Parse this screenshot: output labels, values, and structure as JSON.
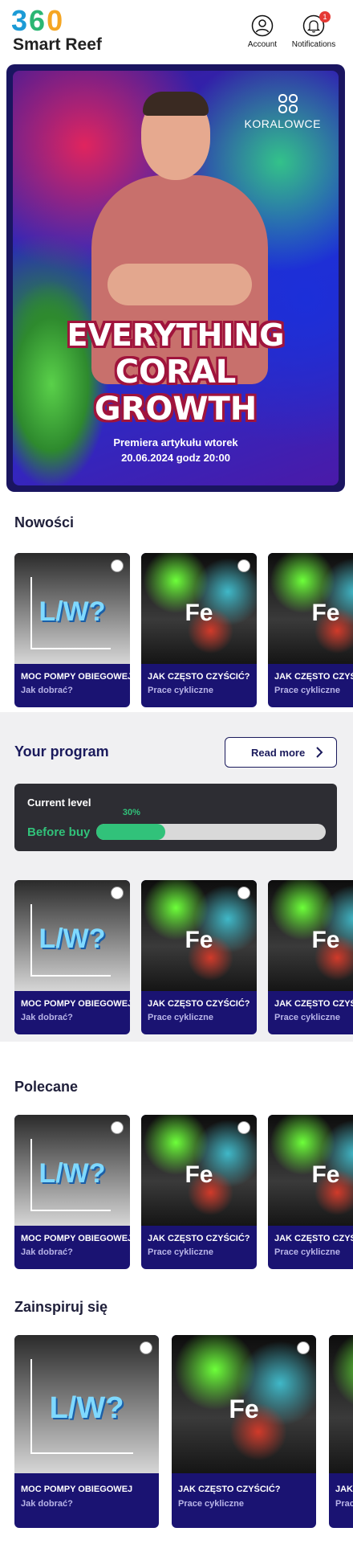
{
  "header": {
    "logo_number": "360",
    "logo_text": "Smart Reef",
    "account_label": "Account",
    "notifications_label": "Notifications",
    "notifications_count": "1"
  },
  "hero": {
    "brand": "KORALOWCE",
    "title_line1": "EVERYTHING",
    "title_line2": "CORAL",
    "title_line3": "GROWTH",
    "subtitle_line1": "Premiera artykułu wtorek",
    "subtitle_line2": "20.06.2024 godz 20:00"
  },
  "sections": {
    "nowosci": "Nowości",
    "program": "Your program",
    "polecane": "Polecane",
    "zainspiruj": "Zainspiruj się"
  },
  "program": {
    "read_more": "Read more",
    "current_level_label": "Current level",
    "stage": "Before buy",
    "progress_percent": 30,
    "progress_label": "30%"
  },
  "cards": [
    {
      "image_text": "L/W?",
      "title": "MOC POMPY OBIEGOWEJ",
      "subtitle": "Jak dobrać?"
    },
    {
      "image_text": "Fe",
      "title": "JAK CZĘSTO CZYŚCIĆ?",
      "subtitle": "Prace cykliczne"
    },
    {
      "image_text": "Fe",
      "title": "JAK CZĘSTO CZYŚCIĆ?",
      "subtitle": "Prace cykliczne"
    }
  ],
  "colors": {
    "brand_navy": "#1a1372",
    "accent_green": "#31c27a",
    "hero_frame": "#1a1560",
    "title_outline": "#a0143c"
  }
}
